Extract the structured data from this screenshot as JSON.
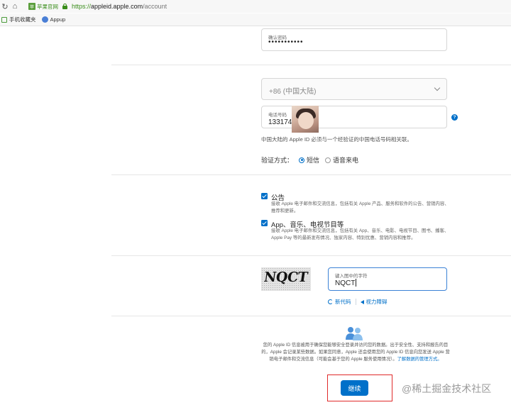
{
  "browser": {
    "site_badge": "苹果官网",
    "site_logo": "苹",
    "url_scheme": "https://",
    "url_host": "appleid.apple.com",
    "url_path": "/account",
    "bookmarks": [
      {
        "label": "手机收藏夹",
        "icon": "folder-icon"
      },
      {
        "label": "Appup",
        "icon": "globe-icon"
      }
    ]
  },
  "form": {
    "confirm_password": {
      "label": "确认密码",
      "value": "•••••••••••"
    },
    "country_code": {
      "value": "+86 (中国大陆)"
    },
    "phone": {
      "label": "电话号码",
      "value": "133174"
    },
    "phone_note": "中国大陆的 Apple ID 必须与一个经验证的中国电话号码相关联。",
    "verify": {
      "label": "验证方式：",
      "options": [
        {
          "label": "短信",
          "selected": true
        },
        {
          "label": "语音来电",
          "selected": false
        }
      ]
    },
    "subscriptions": [
      {
        "title": "公告",
        "description": "接收 Apple 电子邮件和交流信息，包括有关 Apple 产品、服务和软件的公告、营销内容、推荐和更新。",
        "checked": true
      },
      {
        "title": "App、音乐、电视节目等",
        "description": "接收 Apple 电子邮件和交流信息，包括有关 App、音乐、电影、电视节目、图书、播客、Apple Pay 等的最新发布情况、独家内容、特别优惠、营销内容和推荐。",
        "checked": true
      }
    ],
    "captcha": {
      "image_text": "NQCT",
      "label": "键入图中的字符",
      "value": "NQCT",
      "new_code": "新代码",
      "vision_impaired": "视力障碍"
    },
    "privacy_text": "您的 Apple ID 信息被用于确保您能够安全登录并访问您的数据。出于安全性、支持和报告的目的，Apple 会记录某些数据。如果您同意，Apple 还会使用您的 Apple ID 信息向您发送 Apple 营销电子邮件和交流信息（可能会基于您的 Apple 服务使用情况）。",
    "privacy_link": "了解数据的管理方式。",
    "continue_label": "继续"
  },
  "watermark": "@稀土掘金技术社区",
  "colors": {
    "accent": "#0070c9",
    "highlight_frame": "#e02a2a",
    "secure_green": "#3a8e1b"
  }
}
